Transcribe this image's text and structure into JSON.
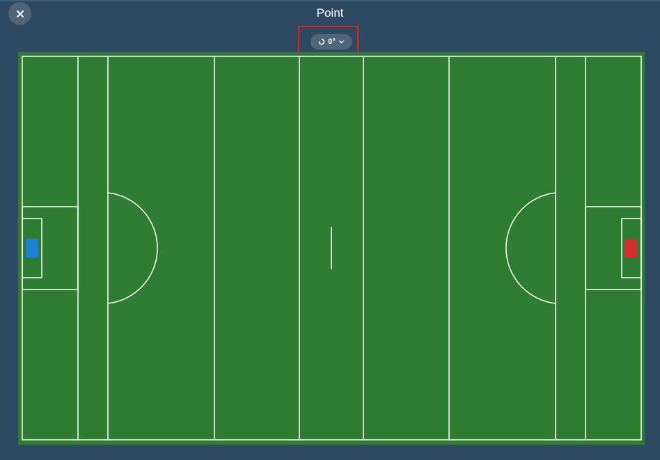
{
  "header": {
    "title": "Point",
    "close_icon": "close-icon"
  },
  "rotation": {
    "value": "0°",
    "icon": "rotate-icon",
    "dropdown_icon": "chevron-down-icon"
  },
  "field": {
    "grass_color": "#2e7d32",
    "line_color": "#ffffff"
  },
  "goals": {
    "left_color": "#1e7fd8",
    "right_color": "#d32f2f"
  },
  "colors": {
    "background": "#2e4a62",
    "highlight": "#e02020"
  }
}
